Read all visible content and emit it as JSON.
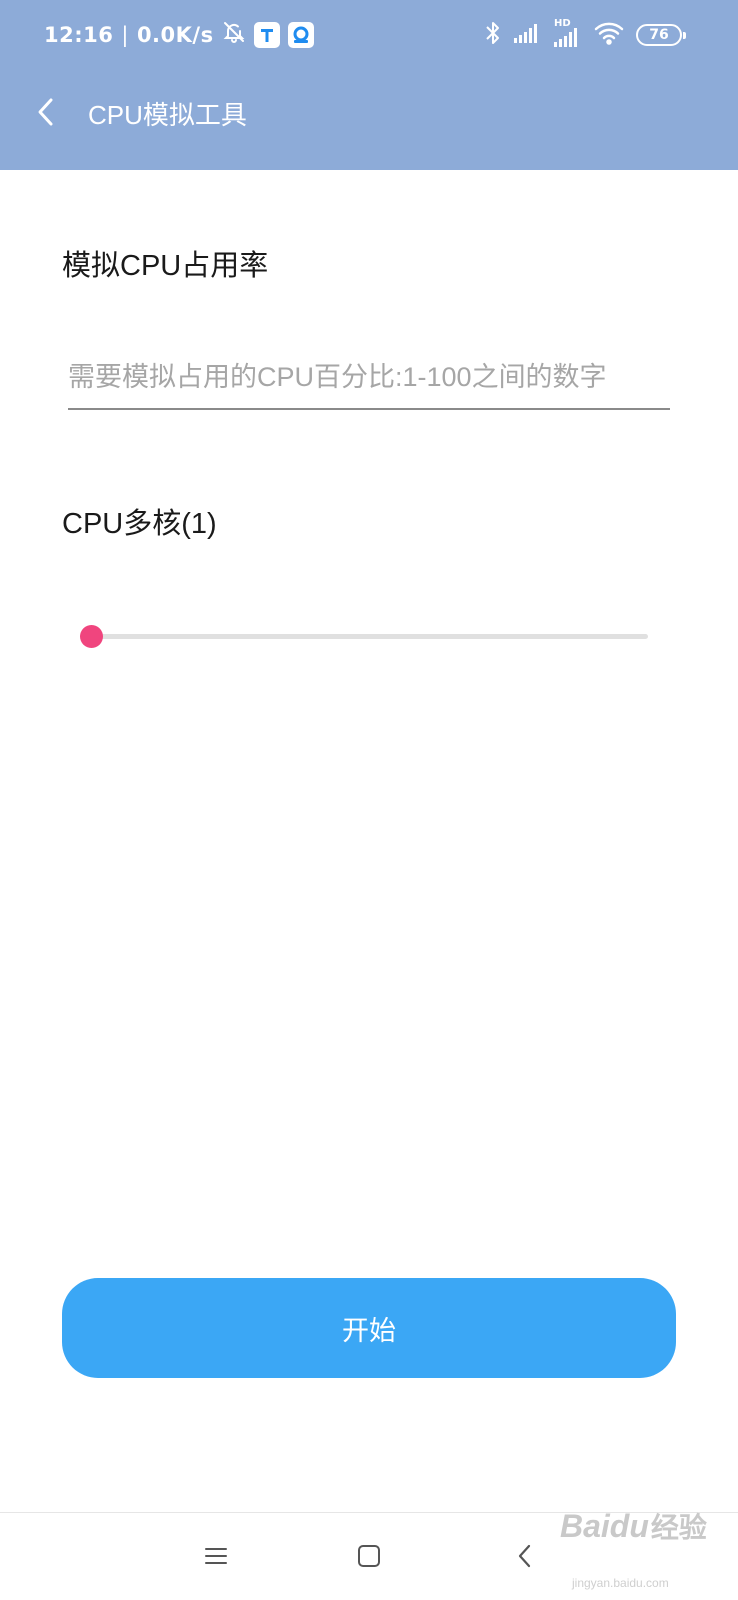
{
  "status_bar": {
    "time": "12:16",
    "separator": "|",
    "network_speed": "0.0K/s",
    "battery": "76",
    "hd_label": "HD",
    "icons": [
      "bell-off-icon",
      "app-t-icon",
      "app-camera-icon",
      "bluetooth-icon",
      "signal-icon",
      "signal-hd-icon",
      "wifi-icon",
      "battery-icon"
    ]
  },
  "app_bar": {
    "title": "CPU模拟工具",
    "back_icon": "chevron-left-icon"
  },
  "form": {
    "cpu_usage_label": "模拟CPU占用率",
    "cpu_usage_input": {
      "value": "",
      "placeholder": "需要模拟占用的CPU百分比:1-100之间的数字"
    },
    "cores_label": "CPU多核(1)",
    "cores_slider": {
      "min": 1,
      "max": 8,
      "value": 1
    }
  },
  "actions": {
    "start_label": "开始"
  },
  "navigation_bar": {
    "icons": [
      "menu-icon",
      "home-icon",
      "back-icon"
    ]
  },
  "watermark": {
    "brand": "Baidu",
    "suffix": "经验",
    "url": "jingyan.baidu.com"
  },
  "colors": {
    "header": "#8dabd8",
    "accent_button": "#3ba7f5",
    "slider_thumb": "#f0457e",
    "slider_track": "#e0e0e0"
  }
}
